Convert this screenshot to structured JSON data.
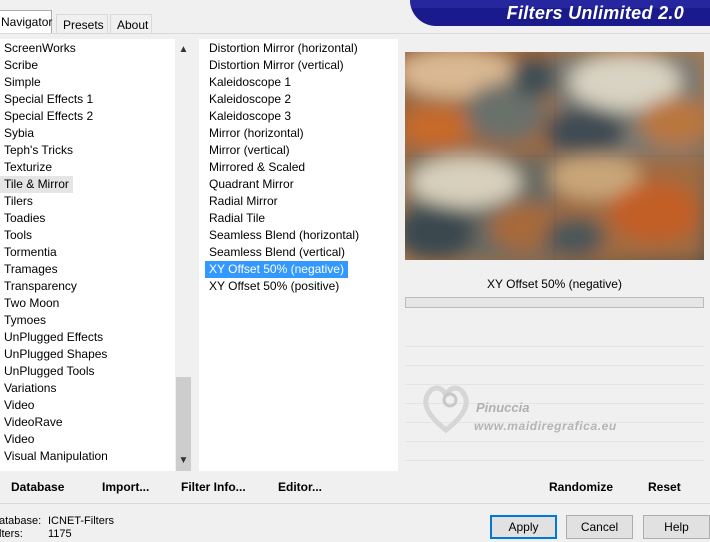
{
  "tabs": [
    "Navigator",
    "Presets",
    "About"
  ],
  "title": "Filters Unlimited 2.0",
  "categories": [
    "ScreenWorks",
    "Scribe",
    "Simple",
    "Special Effects 1",
    "Special Effects 2",
    "Sybia",
    "Teph's Tricks",
    "Texturize",
    "Tile & Mirror",
    "Tilers",
    "Toadies",
    "Tools",
    "Tormentia",
    "Tramages",
    "Transparency",
    "Two Moon",
    "Tymoes",
    "UnPlugged Effects",
    "UnPlugged Shapes",
    "UnPlugged Tools",
    "Variations",
    "Video",
    "VideoRave",
    "Video",
    "Visual Manipulation"
  ],
  "selected_category": "Tile & Mirror",
  "filters": [
    "Distortion Mirror (horizontal)",
    "Distortion Mirror (vertical)",
    "Kaleidoscope 1",
    "Kaleidoscope 2",
    "Kaleidoscope 3",
    "Mirror (horizontal)",
    "Mirror (vertical)",
    "Mirrored & Scaled",
    "Quadrant Mirror",
    "Radial Mirror",
    "Radial Tile",
    "Seamless Blend (horizontal)",
    "Seamless Blend (vertical)",
    "XY Offset 50% (negative)",
    "XY Offset 50% (positive)"
  ],
  "selected_filter": "XY Offset 50% (negative)",
  "preview_filter_name": "XY Offset 50% (negative)",
  "icons": {
    "scroll_up": "▲",
    "scroll_down": "▼"
  },
  "watermark": {
    "line1": "Pinuccia",
    "line2": "www.maidiregrafica.eu"
  },
  "bottom_links": {
    "database": "Database",
    "import": "Import...",
    "filter_info": "Filter Info...",
    "editor": "Editor...",
    "randomize": "Randomize",
    "reset": "Reset"
  },
  "status": {
    "database_label": "atabase:",
    "database_value": "ICNET-Filters",
    "filters_label": "lters:",
    "filters_value": "1175"
  },
  "buttons": {
    "apply": "Apply",
    "cancel": "Cancel",
    "help": "Help"
  },
  "colors": {
    "banner": "#1a1a8c",
    "selection": "#3399ff"
  }
}
